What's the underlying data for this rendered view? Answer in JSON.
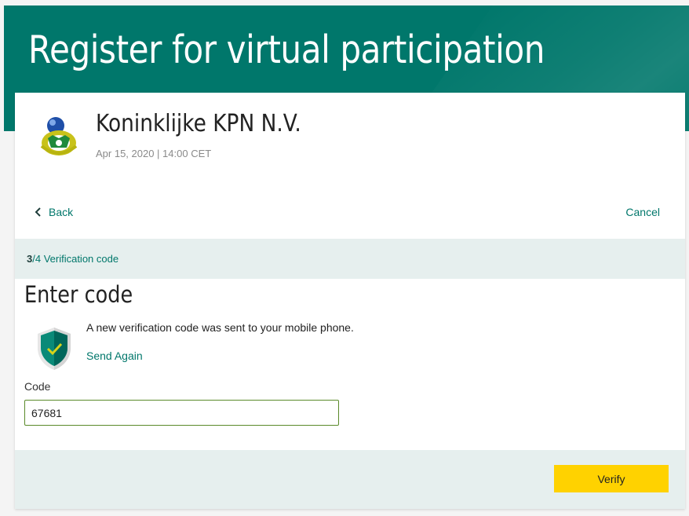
{
  "header": {
    "title": "Register for virtual participation",
    "background_color": "#00776b"
  },
  "meeting": {
    "company_name": "Koninklijke KPN N.V.",
    "date_time": "Apr 15, 2020 | 14:00 CET",
    "logo_icon": "kpn-logo"
  },
  "navigation": {
    "back_label": "Back",
    "cancel_label": "Cancel"
  },
  "progress": {
    "current_step": "3",
    "step_suffix": "/4 Verification code"
  },
  "verification": {
    "title": "Enter code",
    "message": "A new verification code was sent to your mobile phone.",
    "send_again_label": "Send Again",
    "icon": "shield-check-icon"
  },
  "form": {
    "code_label": "Code",
    "code_value": "67681"
  },
  "actions": {
    "verify_label": "Verify",
    "verify_color": "#ffd200"
  }
}
